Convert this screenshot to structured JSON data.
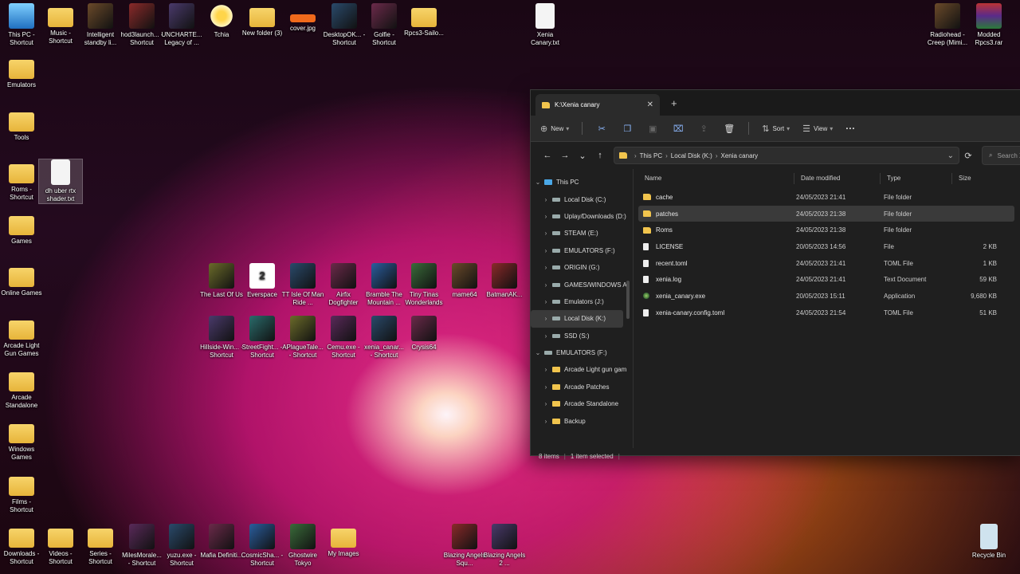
{
  "desktop": {
    "icons": [
      {
        "label": "This PC - Shortcut",
        "kind": "pc"
      },
      {
        "label": "Music - Shortcut",
        "kind": "folder"
      },
      {
        "label": "Intelligent standby li...",
        "kind": "game"
      },
      {
        "label": "hod3launch... - Shortcut",
        "kind": "game"
      },
      {
        "label": "UNCHARTE... Legacy of ...",
        "kind": "game"
      },
      {
        "label": "Tchia",
        "kind": "flower"
      },
      {
        "label": "New folder (3)",
        "kind": "folder"
      },
      {
        "label": "cover.jpg",
        "kind": "image"
      },
      {
        "label": "DesktopOK... - Shortcut",
        "kind": "game"
      },
      {
        "label": "Golfie - Shortcut",
        "kind": "game"
      },
      {
        "label": "Rpcs3-Sailo...",
        "kind": "folder"
      },
      {
        "label": "Xenia Canary.txt",
        "kind": "file"
      },
      {
        "label": "Radiohead - Creep (Mimi...",
        "kind": "game"
      },
      {
        "label": "Modded Rpcs3.rar",
        "kind": "archive"
      },
      {
        "label": "Emulators",
        "kind": "folder"
      },
      {
        "label": "Tools",
        "kind": "folder"
      },
      {
        "label": "Roms - Shortcut",
        "kind": "folder"
      },
      {
        "label": "dh uber rtx shader.txt",
        "kind": "file"
      },
      {
        "label": "Games",
        "kind": "folder"
      },
      {
        "label": "Online Games",
        "kind": "folder"
      },
      {
        "label": "Arcade Light Gun Games",
        "kind": "folder"
      },
      {
        "label": "Arcade Standalone",
        "kind": "folder"
      },
      {
        "label": "Windows Games",
        "kind": "folder"
      },
      {
        "label": "Films - Shortcut",
        "kind": "folder"
      },
      {
        "label": "Downloads - Shortcut",
        "kind": "folder"
      },
      {
        "label": "Videos - Shortcut",
        "kind": "folder"
      },
      {
        "label": "Series - Shortcut",
        "kind": "folder"
      },
      {
        "label": "MilesMorale... - Shortcut",
        "kind": "game"
      },
      {
        "label": "yuzu.exe - Shortcut",
        "kind": "game"
      },
      {
        "label": "Mafia Definiti...",
        "kind": "game"
      },
      {
        "label": "CosmicSha... - Shortcut",
        "kind": "game"
      },
      {
        "label": "Ghostwire Tokyo",
        "kind": "game"
      },
      {
        "label": "My Images",
        "kind": "folder"
      },
      {
        "label": "Blazing Angels Squ...",
        "kind": "game"
      },
      {
        "label": "Blazing Angels 2 ...",
        "kind": "game"
      },
      {
        "label": "Recycle Bin",
        "kind": "bin"
      },
      {
        "label": "The Last Of Us",
        "kind": "game"
      },
      {
        "label": "Everspace",
        "kind": "game2"
      },
      {
        "label": "TT Isle Of Man Ride ...",
        "kind": "game"
      },
      {
        "label": "Airfix Dogfighter",
        "kind": "game"
      },
      {
        "label": "Bramble The Mountain ...",
        "kind": "game"
      },
      {
        "label": "Tiny Tinas Wonderlands",
        "kind": "game"
      },
      {
        "label": "mame64",
        "kind": "game"
      },
      {
        "label": "BatmanAK...",
        "kind": "game"
      },
      {
        "label": "Hillside-Win... - Shortcut",
        "kind": "game"
      },
      {
        "label": "StreetFight... - Shortcut",
        "kind": "game"
      },
      {
        "label": "APlagueTale... - Shortcut",
        "kind": "game"
      },
      {
        "label": "Cemu.exe - Shortcut",
        "kind": "game"
      },
      {
        "label": "xenia_canar... - Shortcut",
        "kind": "game"
      },
      {
        "label": "Crysis64",
        "kind": "game"
      }
    ]
  },
  "explorer": {
    "tab_title": "K:\\Xenia canary",
    "toolbar": {
      "new_label": "New",
      "sort_label": "Sort",
      "view_label": "View"
    },
    "breadcrumb": [
      "This PC",
      "Local Disk (K:)",
      "Xenia canary"
    ],
    "search_placeholder": "Search Xenia ca",
    "nav": [
      {
        "label": "This PC",
        "icon": "pc",
        "level": 0,
        "expander": "v"
      },
      {
        "label": "Local Disk (C:)",
        "icon": "drive",
        "level": 1,
        "expander": ">"
      },
      {
        "label": "Uplay/Downloads (D:)",
        "icon": "drive",
        "level": 1,
        "expander": ">"
      },
      {
        "label": "STEAM (E:)",
        "icon": "drive",
        "level": 1,
        "expander": ">"
      },
      {
        "label": "EMULATORS (F:)",
        "icon": "drive",
        "level": 1,
        "expander": ">"
      },
      {
        "label": "ORIGIN (G:)",
        "icon": "drive",
        "level": 1,
        "expander": ">"
      },
      {
        "label": "GAMES/WINDOWS AI",
        "icon": "drive",
        "level": 1,
        "expander": ">"
      },
      {
        "label": "Emulators (J:)",
        "icon": "drive",
        "level": 1,
        "expander": ">"
      },
      {
        "label": "Local Disk (K:)",
        "icon": "drive",
        "level": 1,
        "expander": ">",
        "selected": true
      },
      {
        "label": "SSD (S:)",
        "icon": "drive",
        "level": 1,
        "expander": ">"
      },
      {
        "label": "EMULATORS (F:)",
        "icon": "drive",
        "level": 0,
        "expander": "v"
      },
      {
        "label": "Arcade Light gun gam",
        "icon": "folder",
        "level": 1,
        "expander": ">"
      },
      {
        "label": "Arcade Patches",
        "icon": "folder",
        "level": 1,
        "expander": ">"
      },
      {
        "label": "Arcade Standalone",
        "icon": "folder",
        "level": 1,
        "expander": ">"
      },
      {
        "label": "Backup",
        "icon": "folder",
        "level": 1,
        "expander": ">"
      }
    ],
    "columns": {
      "name": "Name",
      "date": "Date modified",
      "type": "Type",
      "size": "Size"
    },
    "files": [
      {
        "name": "cache",
        "date": "24/05/2023 21:41",
        "type": "File folder",
        "size": "",
        "icon": "folder"
      },
      {
        "name": "patches",
        "date": "24/05/2023 21:38",
        "type": "File folder",
        "size": "",
        "icon": "folder",
        "selected": true
      },
      {
        "name": "Roms",
        "date": "24/05/2023 21:38",
        "type": "File folder",
        "size": "",
        "icon": "folder"
      },
      {
        "name": "LICENSE",
        "date": "20/05/2023 14:56",
        "type": "File",
        "size": "2 KB",
        "icon": "file"
      },
      {
        "name": "recent.toml",
        "date": "24/05/2023 21:41",
        "type": "TOML File",
        "size": "1 KB",
        "icon": "file"
      },
      {
        "name": "xenia.log",
        "date": "24/05/2023 21:41",
        "type": "Text Document",
        "size": "59 KB",
        "icon": "file"
      },
      {
        "name": "xenia_canary.exe",
        "date": "20/05/2023 15:11",
        "type": "Application",
        "size": "9,680 KB",
        "icon": "app"
      },
      {
        "name": "xenia-canary.config.toml",
        "date": "24/05/2023 21:54",
        "type": "TOML File",
        "size": "51 KB",
        "icon": "file"
      }
    ],
    "status": {
      "items": "8 items",
      "selected": "1 item selected"
    }
  }
}
